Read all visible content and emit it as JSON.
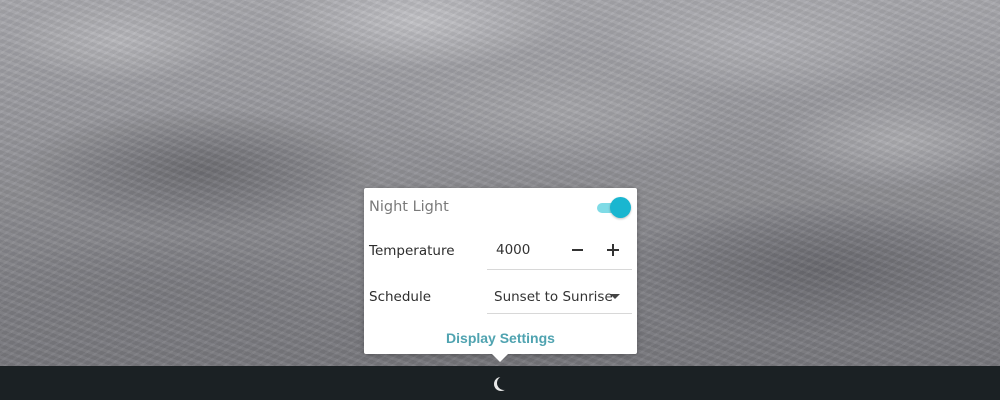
{
  "popover": {
    "title": "Night Light",
    "enabled": true,
    "temperature": {
      "label": "Temperature",
      "value": "4000"
    },
    "schedule": {
      "label": "Schedule",
      "value": "Sunset to Sunrise"
    },
    "link": "Display Settings"
  },
  "panel": {
    "indicator_icon": "moon-icon"
  },
  "colors": {
    "accent": "#1ab6d0",
    "link": "#4fa3b0",
    "panel_bg": "#1b2124"
  }
}
